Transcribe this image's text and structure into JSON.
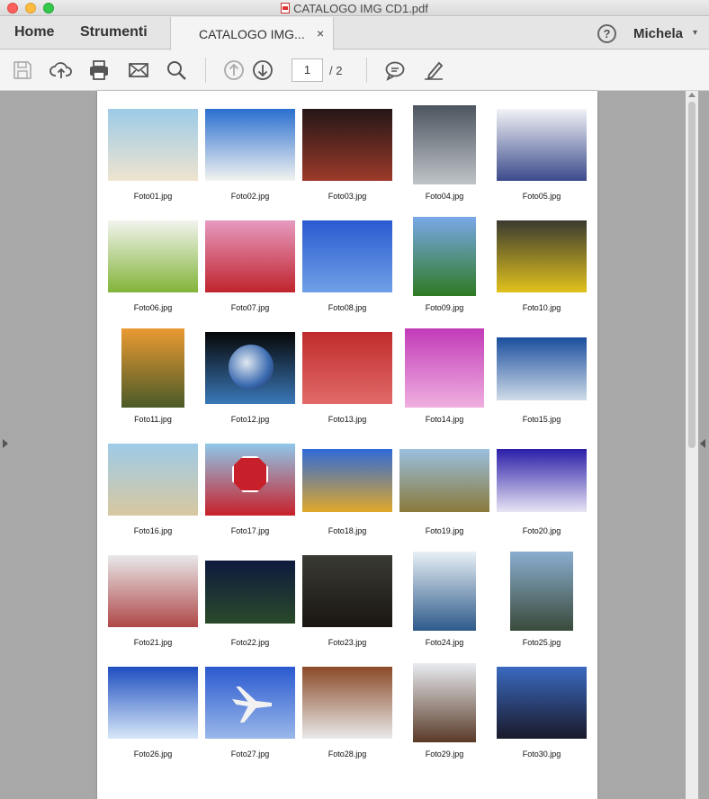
{
  "window": {
    "title": "CATALOGO IMG CD1.pdf"
  },
  "tabs": {
    "home": "Home",
    "tools": "Strumenti",
    "doc": "CATALOGO IMG...",
    "close": "×"
  },
  "account": {
    "help": "?",
    "user": "Michela",
    "caret": "▾"
  },
  "toolbar": {
    "icons": [
      "save-icon",
      "upload-icon",
      "print-icon",
      "mail-icon",
      "search-icon",
      "prev-page-icon",
      "next-page-icon",
      "comment-icon",
      "sign-icon"
    ],
    "page_current": "1",
    "page_total": "/ 2"
  },
  "photos": [
    {
      "caption": "Foto01.jpg",
      "top": "#9ccbe8",
      "bottom": "#efe4cf",
      "shape": "portrait-none"
    },
    {
      "caption": "Foto02.jpg",
      "top": "#2a6fd0",
      "bottom": "#f3f3f0",
      "shape": "none"
    },
    {
      "caption": "Foto03.jpg",
      "top": "#241616",
      "bottom": "#9c3a2a",
      "shape": "none"
    },
    {
      "caption": "Foto04.jpg",
      "top": "#4d5560",
      "bottom": "#bfc4c8",
      "shape": "portrait"
    },
    {
      "caption": "Foto05.jpg",
      "top": "#f1f3f6",
      "bottom": "#3c4a8c",
      "shape": "none"
    },
    {
      "caption": "Foto06.jpg",
      "top": "#f2f4ee",
      "bottom": "#82b438",
      "shape": "none"
    },
    {
      "caption": "Foto07.jpg",
      "top": "#e69ac0",
      "bottom": "#c0242c",
      "shape": "none"
    },
    {
      "caption": "Foto08.jpg",
      "top": "#2a5ad0",
      "bottom": "#6fa0e6",
      "shape": "none"
    },
    {
      "caption": "Foto09.jpg",
      "top": "#7aa8e8",
      "bottom": "#2e7a23",
      "shape": "portrait"
    },
    {
      "caption": "Foto10.jpg",
      "top": "#3a3a30",
      "bottom": "#e1c21c",
      "shape": "none"
    },
    {
      "caption": "Foto11.jpg",
      "top": "#ea9a32",
      "bottom": "#4a5a28",
      "shape": "portrait"
    },
    {
      "caption": "Foto12.jpg",
      "top": "#060606",
      "bottom": "#3a78b8",
      "shape": "globe"
    },
    {
      "caption": "Foto13.jpg",
      "top": "#c02c2c",
      "bottom": "#e06a68",
      "shape": "none"
    },
    {
      "caption": "Foto14.jpg",
      "top": "#c23ab8",
      "bottom": "#f0b0e0",
      "shape": "portrait-wide"
    },
    {
      "caption": "Foto15.jpg",
      "top": "#1b4e9e",
      "bottom": "#d0dce8",
      "shape": "short"
    },
    {
      "caption": "Foto16.jpg",
      "top": "#9ecbe8",
      "bottom": "#d8c8a0",
      "shape": "none"
    },
    {
      "caption": "Foto17.jpg",
      "top": "#8ec8ea",
      "bottom": "#c8202a",
      "shape": "stop"
    },
    {
      "caption": "Foto18.jpg",
      "top": "#2f6ad8",
      "bottom": "#e0a82a",
      "shape": "short"
    },
    {
      "caption": "Foto19.jpg",
      "top": "#9ac0e0",
      "bottom": "#8a7a3a",
      "shape": "short"
    },
    {
      "caption": "Foto20.jpg",
      "top": "#2a1ea8",
      "bottom": "#e8e4f4",
      "shape": "short"
    },
    {
      "caption": "Foto21.jpg",
      "top": "#e8e8ea",
      "bottom": "#b04848",
      "shape": "none"
    },
    {
      "caption": "Foto22.jpg",
      "top": "#0e1a3e",
      "bottom": "#2a4a2a",
      "shape": "short"
    },
    {
      "caption": "Foto23.jpg",
      "top": "#3a3a34",
      "bottom": "#1a1612",
      "shape": "none"
    },
    {
      "caption": "Foto24.jpg",
      "top": "#e8f0f6",
      "bottom": "#2e5a8a",
      "shape": "portrait"
    },
    {
      "caption": "Foto25.jpg",
      "top": "#8aaed0",
      "bottom": "#3a4a3a",
      "shape": "portrait"
    },
    {
      "caption": "Foto26.jpg",
      "top": "#1e4ec0",
      "bottom": "#d8e8f8",
      "shape": "none"
    },
    {
      "caption": "Foto27.jpg",
      "top": "#2a5ad0",
      "bottom": "#9ab8ea",
      "shape": "plane"
    },
    {
      "caption": "Foto28.jpg",
      "top": "#8a4a28",
      "bottom": "#eaeaea",
      "shape": "none"
    },
    {
      "caption": "Foto29.jpg",
      "top": "#e8ecf0",
      "bottom": "#5a3a28",
      "shape": "portrait"
    },
    {
      "caption": "Foto30.jpg",
      "top": "#3a6ac0",
      "bottom": "#1a1a2a",
      "shape": "none"
    }
  ]
}
